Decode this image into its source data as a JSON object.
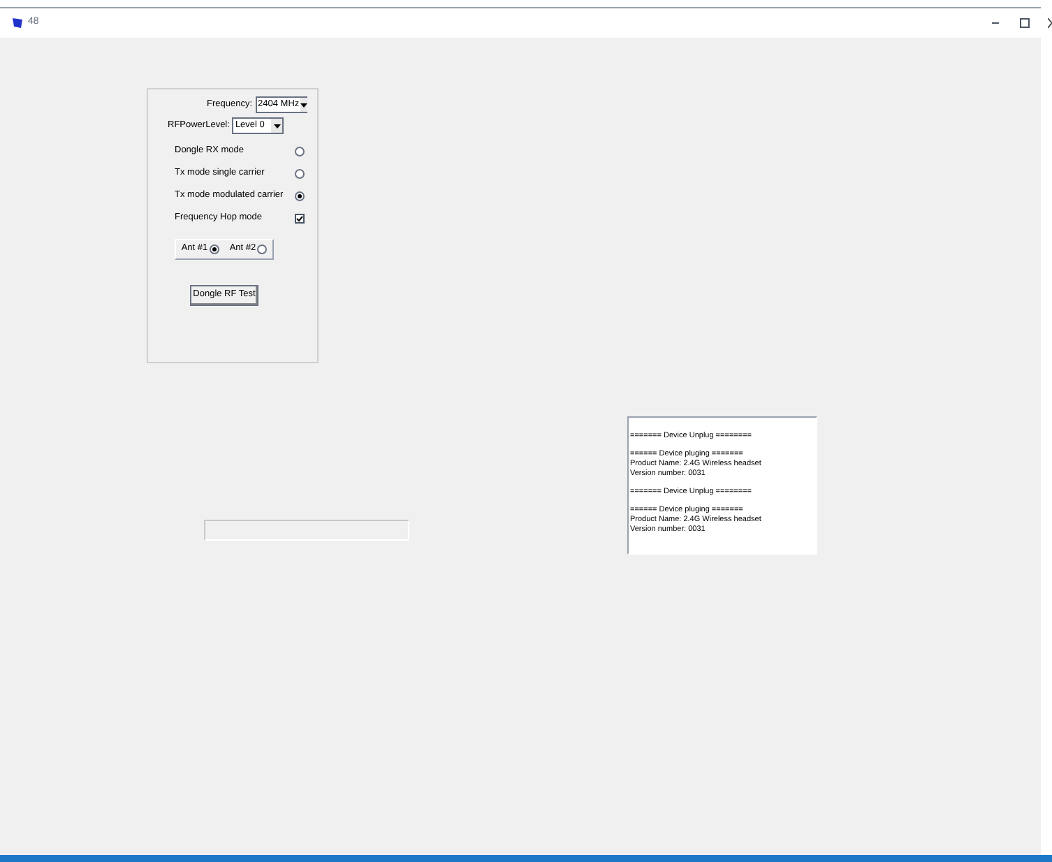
{
  "window": {
    "title": "48"
  },
  "settings": {
    "frequency": {
      "label": "Frequency:",
      "value": "2404 MHz"
    },
    "power": {
      "label": "RFPowerLevel:",
      "value": "Level 0"
    },
    "modes": [
      {
        "label": "Dongle RX mode",
        "kind": "radio",
        "checked": false
      },
      {
        "label": "Tx mode single carrier",
        "kind": "radio",
        "checked": false
      },
      {
        "label": "Tx mode modulated carrier",
        "kind": "radio",
        "checked": true
      },
      {
        "label": "Frequency Hop mode",
        "kind": "checkbox",
        "checked": true
      }
    ],
    "antennas": [
      {
        "label": "Ant #1",
        "selected": true
      },
      {
        "label": "Ant #2",
        "selected": false
      }
    ],
    "test_button": "Dongle RF Test"
  },
  "log": [
    {
      "lines": [
        "======= Device Unplug ========"
      ]
    },
    {
      "lines": [
        "====== Device pluging =======",
        "Product Name: 2.4G Wireless headset",
        "Version number: 0031"
      ]
    },
    {
      "lines": [
        "======= Device Unplug ========"
      ]
    },
    {
      "lines": [
        "====== Device pluging =======",
        "Product Name: 2.4G Wireless headset",
        "Version number: 0031"
      ]
    }
  ]
}
